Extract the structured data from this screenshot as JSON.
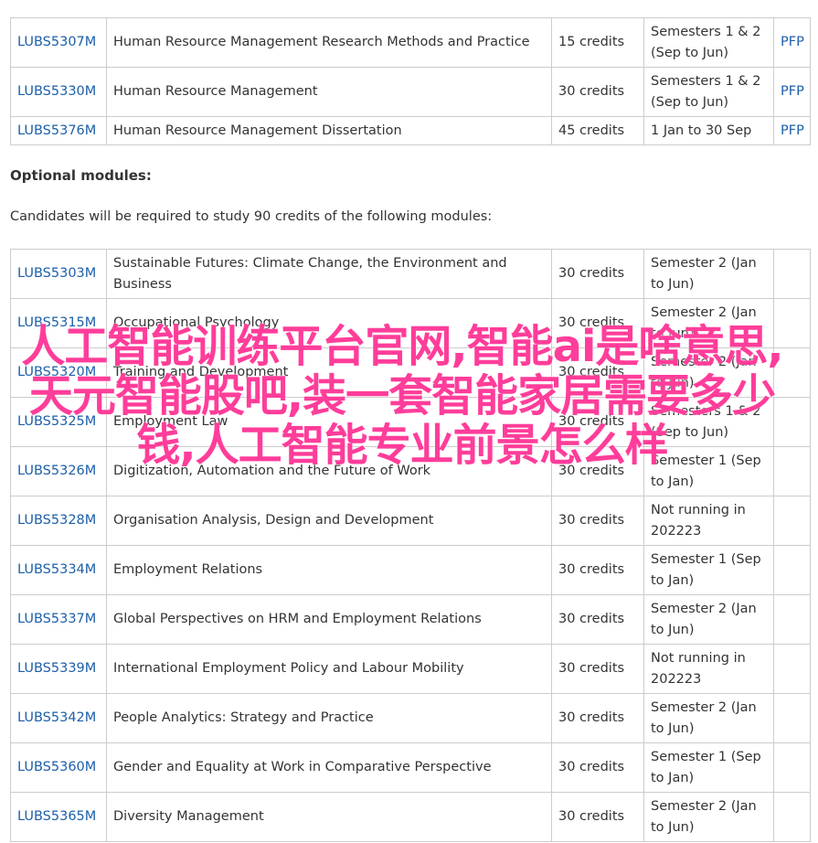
{
  "compulsory_modules": [
    {
      "code": "LUBS5307M",
      "title": "Human Resource Management Research Methods and Practice",
      "credits": "15 credits",
      "semester": "Semesters 1 & 2 (Sep to Jun)",
      "link": "PFP"
    },
    {
      "code": "LUBS5330M",
      "title": "Human Resource Management",
      "credits": "30 credits",
      "semester": "Semesters 1 & 2 (Sep to Jun)",
      "link": "PFP"
    },
    {
      "code": "LUBS5376M",
      "title": "Human Resource Management Dissertation",
      "credits": "45 credits",
      "semester": "1 Jan to 30 Sep",
      "link": "PFP"
    }
  ],
  "optional_section": {
    "title": "Optional modules:",
    "description": "Candidates will be required to study 90 credits of the following modules:"
  },
  "optional_modules": [
    {
      "code": "LUBS5303M",
      "title": "Sustainable Futures: Climate Change, the Environment and Business",
      "credits": "30 credits",
      "semester": "Semester 2 (Jan to Jun)"
    },
    {
      "code": "LUBS5315M",
      "title": "Occupational Psychology",
      "credits": "30 credits",
      "semester": "Semester 2 (Jan to Jun)"
    },
    {
      "code": "LUBS5320M",
      "title": "Training and Development",
      "credits": "30 credits",
      "semester": "Semester 2 (Jan to Jun)"
    },
    {
      "code": "LUBS5325M",
      "title": "Employment Law",
      "credits": "30 credits",
      "semester": "Semesters 1 & 2 (Sep to Jun)"
    },
    {
      "code": "LUBS5326M",
      "title": "Digitization, Automation and the Future of Work",
      "credits": "30 credits",
      "semester": "Semester 1 (Sep to Jan)"
    },
    {
      "code": "LUBS5328M",
      "title": "Organisation Analysis, Design and Development",
      "credits": "30 credits",
      "semester": "Not running in 202223"
    },
    {
      "code": "LUBS5334M",
      "title": "Employment Relations",
      "credits": "30 credits",
      "semester": "Semester 1 (Sep to Jan)"
    },
    {
      "code": "LUBS5337M",
      "title": "Global Perspectives on HRM and Employment Relations",
      "credits": "30 credits",
      "semester": "Semester 2 (Jan to Jun)"
    },
    {
      "code": "LUBS5339M",
      "title": "International Employment Policy and Labour Mobility",
      "credits": "30 credits",
      "semester": "Not running in 202223"
    },
    {
      "code": "LUBS5342M",
      "title": "People Analytics: Strategy and Practice",
      "credits": "30 credits",
      "semester": "Semester 2 (Jan to Jun)"
    },
    {
      "code": "LUBS5360M",
      "title": "Gender and Equality at Work in Comparative Perspective",
      "credits": "30 credits",
      "semester": "Semester 1 (Sep to Jan)"
    },
    {
      "code": "LUBS5365M",
      "title": "Diversity Management",
      "credits": "30 credits",
      "semester": "Semester 2 (Jan to Jun)"
    }
  ],
  "watermark": {
    "text": "人工智能训练平台官网,智能ai是啥意思,天元智能股吧,装一套智能家居需要多少钱,人工智能专业前景怎么样",
    "color": "#ff3d9a"
  }
}
